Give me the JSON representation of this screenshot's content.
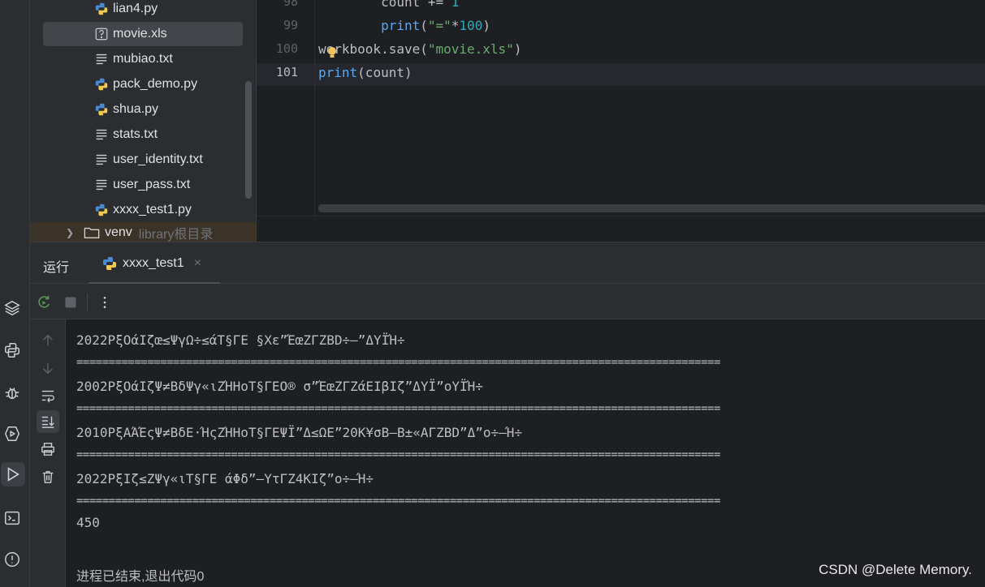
{
  "project_tree": {
    "files": [
      {
        "name": "lian4.py",
        "type": "python"
      },
      {
        "name": "movie.xls",
        "type": "unknown",
        "selected": true
      },
      {
        "name": "mubiao.txt",
        "type": "text"
      },
      {
        "name": "pack_demo.py",
        "type": "python"
      },
      {
        "name": "shua.py",
        "type": "python"
      },
      {
        "name": "stats.txt",
        "type": "text"
      },
      {
        "name": "user_identity.txt",
        "type": "text"
      },
      {
        "name": "user_pass.txt",
        "type": "text"
      },
      {
        "name": "xxxx_test1.py",
        "type": "python"
      }
    ],
    "venv": {
      "label": "venv",
      "hint": "library根目录"
    }
  },
  "editor": {
    "lines": [
      {
        "number": "98",
        "indent": "        ",
        "tokens": [
          {
            "t": "count += ",
            "k": "plain"
          },
          {
            "t": "1",
            "k": "num"
          }
        ]
      },
      {
        "number": "99",
        "indent": "        ",
        "tokens": [
          {
            "t": "print",
            "k": "fn"
          },
          {
            "t": "(",
            "k": "plain"
          },
          {
            "t": "\"=\"",
            "k": "str"
          },
          {
            "t": "*",
            "k": "plain"
          },
          {
            "t": "100",
            "k": "num"
          },
          {
            "t": ")",
            "k": "plain"
          }
        ]
      },
      {
        "number": "100",
        "indent": "",
        "tokens": [
          {
            "t": "workbook.save(",
            "k": "plain"
          },
          {
            "t": "\"movie.xls\"",
            "k": "str"
          },
          {
            "t": ")",
            "k": "plain"
          }
        ]
      },
      {
        "number": "101",
        "indent": "",
        "current": true,
        "tokens": [
          {
            "t": "print",
            "k": "fn"
          },
          {
            "t": "(count)",
            "k": "plain"
          }
        ]
      }
    ]
  },
  "run_panel": {
    "title": "运行",
    "tab_label": "xxxx_test1",
    "tab_close": "×",
    "console": {
      "separator": "====================================================================================================",
      "lines": [
        "2022PξOάIζœ≤ΨγΩ÷≤άT§ΓΕ §Χε”ΈœΖΓΖBD÷–”ΔΥΪΉ÷",
        "2002PξOάIζΨ≠BδΨγ«ιΖΉΗοΤ§ΓΕΟ® σ”ΈœΖΓΖάΕΙβΙζ”ΔΥΪ”οΥΪΉ÷",
        "2010PξΑΆΈςΨ≠BδΕ·ΉςΖΉΗοΤ§ΓΕΨΪ”Δ≤ΩΕ”20Κ¥σΒ–Β±«ΑΓΖBD”Δ”ο÷–Ή÷",
        "2022PξΙζ≤ΖΨγ«ιΤ§ΓΕ άΦδ”–ΥτΓΖ4ΚΙζ”ο÷–Ή÷"
      ],
      "result": "450",
      "exit_message": "进程已结束,退出代码0"
    }
  },
  "watermark": "CSDN @Delete Memory."
}
